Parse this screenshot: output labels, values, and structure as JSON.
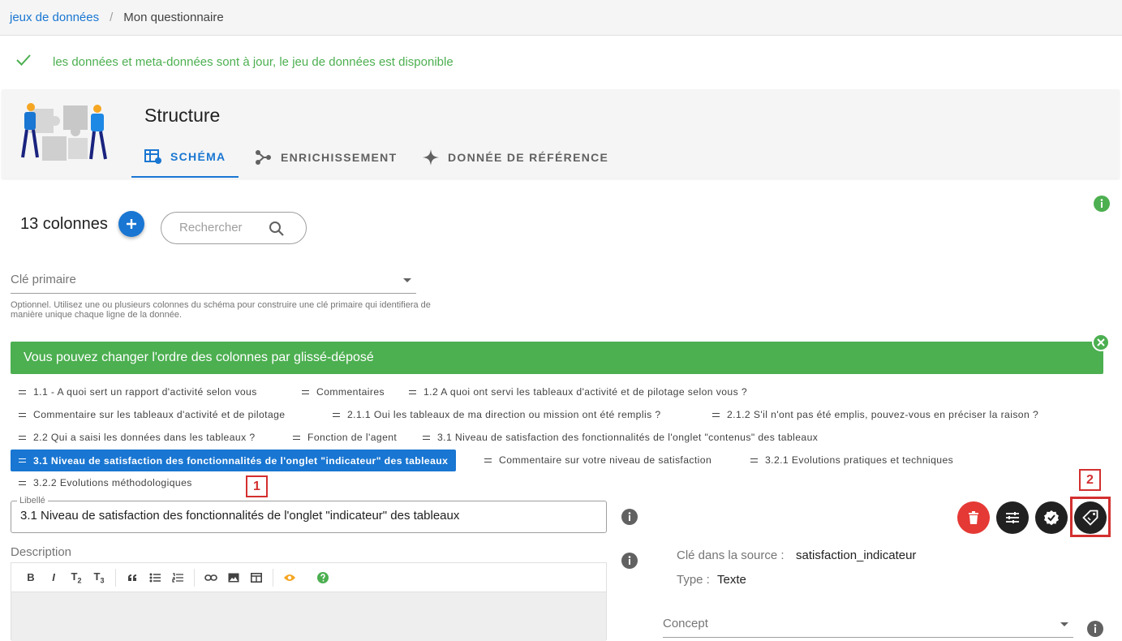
{
  "breadcrumb": {
    "root": "jeux de données",
    "separator": "/",
    "current": "Mon questionnaire"
  },
  "status": {
    "message": "les données et meta-données sont à jour, le jeu de données est disponible",
    "color": "#4caf50"
  },
  "structure": {
    "title": "Structure",
    "tabs": [
      {
        "label": "SCHÉMA",
        "icon": "table-settings-icon",
        "active": true
      },
      {
        "label": "ENRICHISSEMENT",
        "icon": "graph-icon",
        "active": false
      },
      {
        "label": "DONNÉE DE RÉFÉRENCE",
        "icon": "sparkle-icon",
        "active": false
      }
    ]
  },
  "columns": {
    "count_label": "13 colonnes",
    "search_placeholder": "Rechercher"
  },
  "primary_key": {
    "label": "Clé primaire",
    "hint": "Optionnel. Utilisez une ou plusieurs colonnes du schéma pour construire une clé primaire qui identifiera de manière unique chaque ligne de la donnée."
  },
  "banner": {
    "message": "Vous pouvez changer l'ordre des colonnes par glissé-déposé",
    "color": "#4caf50"
  },
  "chips": [
    "1.1 - A quoi sert un rapport d'activité selon vous",
    "Commentaires",
    "1.2 A quoi ont servi les tableaux d'activité et de pilotage selon vous ?",
    "Commentaire sur les tableaux d'activité et de pilotage",
    "2.1.1 Oui les tableaux de ma direction ou mission ont été remplis ?",
    "2.1.2 S'il n'ont pas été emplis, pouvez-vous en préciser la raison ?",
    "2.2 Qui a saisi les données dans les tableaux ?",
    "Fonction de l'agent",
    "3.1 Niveau de satisfaction des fonctionnalités de l'onglet \"contenus\" des tableaux",
    "3.1 Niveau de satisfaction des fonctionnalités de l'onglet \"indicateur\" des tableaux",
    "Commentaire sur votre niveau de satisfaction",
    "3.2.1 Evolutions pratiques et techniques",
    "3.2.2 Evolutions méthodologiques"
  ],
  "annotations": {
    "one": "1",
    "two": "2"
  },
  "field": {
    "libelle_label": "Libellé",
    "libelle_value": "3.1 Niveau de satisfaction des fonctionnalités de l'onglet \"indicateur\" des tableaux",
    "description_label": "Description"
  },
  "editor_toolbar": [
    "B",
    "I",
    "T2",
    "T3",
    "quote",
    "bullet-list",
    "numbered-list",
    "link",
    "image",
    "table",
    "preview",
    "help"
  ],
  "source": {
    "key_label": "Clé dans la source :",
    "key_value": "satisfaction_indicateur",
    "type_label": "Type :",
    "type_value": "Texte"
  },
  "concept": {
    "label": "Concept"
  },
  "colors": {
    "primary": "#1976d2",
    "success": "#4caf50",
    "danger": "#e53935",
    "annotation": "#d32f2f"
  }
}
